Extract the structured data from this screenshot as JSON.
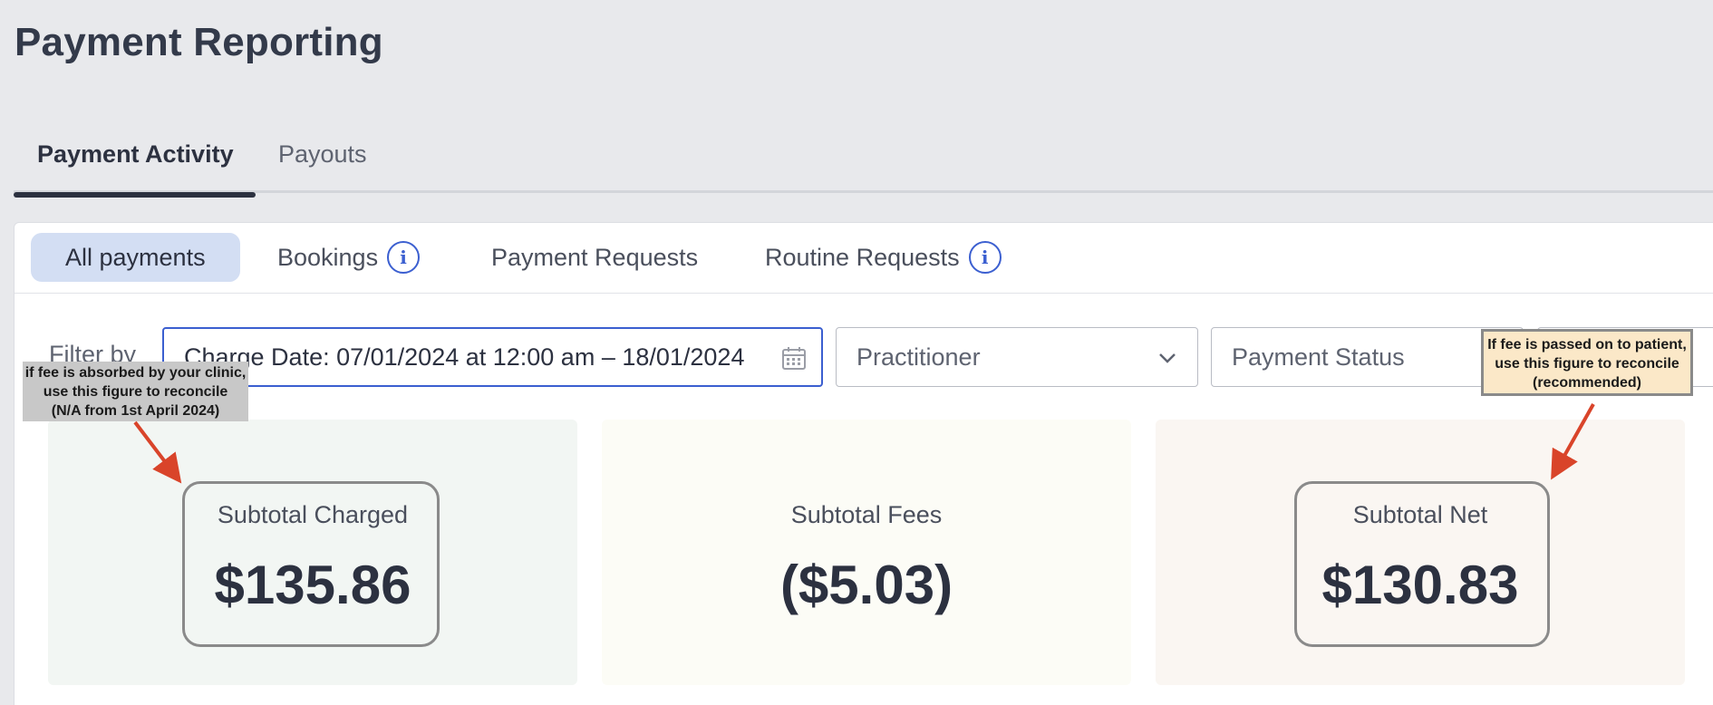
{
  "page": {
    "title": "Payment Reporting"
  },
  "tabs": [
    {
      "label": "Payment Activity",
      "active": true
    },
    {
      "label": "Payouts",
      "active": false
    }
  ],
  "subtabs": {
    "all": "All payments",
    "bookings": "Bookings",
    "payment_requests": "Payment Requests",
    "routine_requests": "Routine Requests",
    "info_glyph": "i"
  },
  "filters": {
    "label": "Filter by",
    "date": "Charge Date: 07/01/2024 at 12:00 am – 18/01/2024",
    "practitioner": "Practitioner",
    "status": "Payment Status"
  },
  "cards": {
    "charged": {
      "label": "Subtotal Charged",
      "value": "$135.86"
    },
    "fees": {
      "label": "Subtotal Fees",
      "value": "($5.03)"
    },
    "net": {
      "label": "Subtotal Net",
      "value": "$130.83"
    }
  },
  "annotations": {
    "left": [
      "if fee is absorbed by your clinic,",
      "use this figure to reconcile",
      "(N/A from 1st April 2024)"
    ],
    "right": [
      "If fee is passed on to patient,",
      "use this figure to reconcile",
      "(recommended)"
    ]
  },
  "colors": {
    "accent": "#3b5fd0",
    "arrow": "#d9442a",
    "active_pill": "#d3def3"
  },
  "icons": {
    "calendar": "calendar-icon",
    "dropdown": "chevron-down-icon",
    "info": "info-icon"
  }
}
